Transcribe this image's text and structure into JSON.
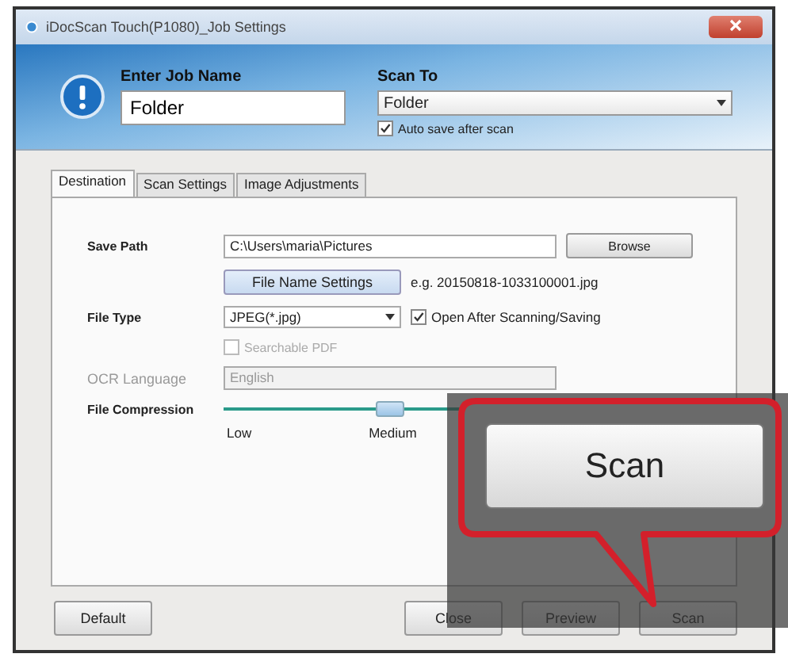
{
  "window": {
    "title": "iDocScan Touch(P1080)_Job Settings"
  },
  "header": {
    "job_name": {
      "label": "Enter Job Name",
      "value": "Folder"
    },
    "scan_to": {
      "label": "Scan To",
      "value": "Folder"
    },
    "auto_save": {
      "label": "Auto save after scan",
      "checked": true
    }
  },
  "tabs": [
    {
      "label": "Destination",
      "selected": true
    },
    {
      "label": "Scan Settings",
      "selected": false
    },
    {
      "label": "Image Adjustments",
      "selected": false
    }
  ],
  "destination": {
    "save_path": {
      "label": "Save Path",
      "value": "C:\\Users\\maria\\Pictures",
      "button": "Browse"
    },
    "file_name": {
      "button": "File Name Settings",
      "example": "e.g. 20150818-1033100001.jpg"
    },
    "file_type": {
      "label": "File Type",
      "value": "JPEG(*.jpg)"
    },
    "open_after": {
      "label": "Open After Scanning/Saving",
      "checked": true
    },
    "searchable_pdf": {
      "label": "Searchable PDF",
      "checked": false,
      "disabled": true
    },
    "ocr_language": {
      "label": "OCR Language",
      "value": "English",
      "disabled": true
    },
    "file_compression": {
      "label": "File Compression",
      "level": 0.5,
      "ticks": [
        "Low",
        "Medium"
      ]
    }
  },
  "buttons": [
    "Default",
    "Close",
    "Preview",
    "Scan"
  ],
  "callout": {
    "label": "Scan"
  }
}
